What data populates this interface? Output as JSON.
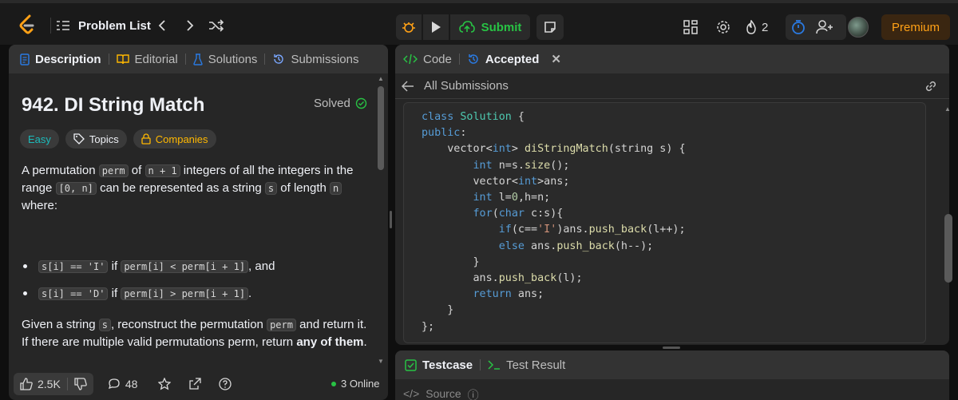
{
  "topbar": {
    "problem_list_label": "Problem List",
    "submit_label": "Submit",
    "streak_count": "2",
    "premium_label": "Premium"
  },
  "left_tabs": [
    {
      "label": "Description",
      "icon": "description-icon"
    },
    {
      "label": "Editorial",
      "icon": "book-icon"
    },
    {
      "label": "Solutions",
      "icon": "flask-icon"
    },
    {
      "label": "Submissions",
      "icon": "history-icon"
    }
  ],
  "problem": {
    "title": "942. DI String Match",
    "status": "Solved",
    "difficulty": "Easy",
    "topics_label": "Topics",
    "companies_label": "Companies",
    "p1": {
      "t1": "A permutation ",
      "c1": "perm",
      "t2": " of ",
      "c2": "n + 1",
      "t3": " integers of all the integers in the range ",
      "c3": "[0, n]",
      "t4": " can be represented as a string ",
      "c4": "s",
      "t5": " of length ",
      "c5": "n",
      "t6": " where:"
    },
    "bullets": [
      {
        "c1": "s[i] == 'I'",
        "t1": " if ",
        "c2": "perm[i] < perm[i + 1]",
        "t2": ", and"
      },
      {
        "c1": "s[i] == 'D'",
        "t1": " if ",
        "c2": "perm[i] > perm[i + 1]",
        "t2": "."
      }
    ],
    "p2": {
      "t1": "Given a string ",
      "c1": "s",
      "t2": ", reconstruct the permutation ",
      "c2": "perm",
      "t3": " and return it. If there are multiple valid permutations perm, return ",
      "b1": "any of them",
      "t4": "."
    }
  },
  "footer": {
    "likes": "2.5K",
    "comments": "48",
    "online": "3 Online"
  },
  "right_tabs": {
    "code_label": "Code",
    "accepted_label": "Accepted",
    "all_submissions_label": "All Submissions"
  },
  "code_lines": [
    "class Solution {",
    "public:",
    "    vector<int> diStringMatch(string s) {",
    "        int n=s.size();",
    "        vector<int>ans;",
    "        int l=0,h=n;",
    "        for(char c:s){",
    "            if(c=='I')ans.push_back(l++);",
    "            else ans.push_back(h--);",
    "        }",
    "        ans.push_back(l);",
    "        return ans;",
    "    }",
    "};"
  ],
  "bottom": {
    "testcase_label": "Testcase",
    "test_result_label": "Test Result",
    "source_label": "Source"
  },
  "colors": {
    "accent_green": "#28c244",
    "premium_orange": "#ffa116",
    "easy_teal": "#1cbaba",
    "link_blue": "#2a7ae2"
  }
}
